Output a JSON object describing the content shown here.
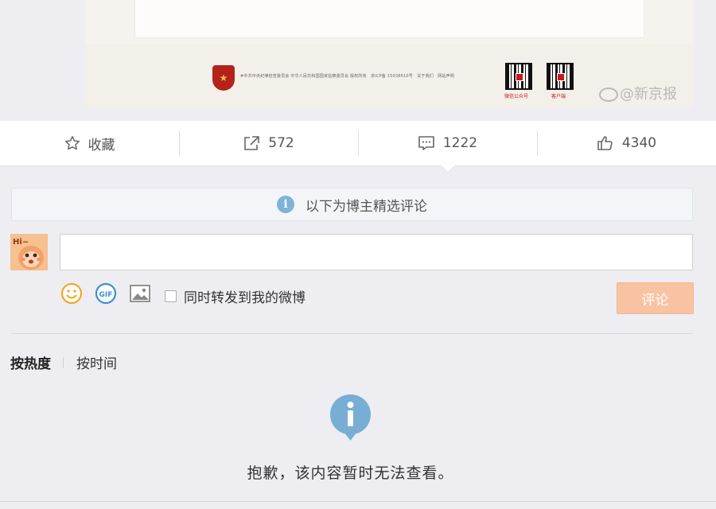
{
  "post_image": {
    "footer_text": "#中共中央纪律检查委员会 中华人民共和国国家监察委员会 版权所有　京ICP备 15038610号　关于我们　网站声明",
    "qr_caption_1": "微信公众号",
    "qr_caption_2": "客户端",
    "watermark": "@新京报"
  },
  "actions": {
    "favorite_label": "收藏",
    "repost_count": "572",
    "comment_count": "1222",
    "like_count": "4340",
    "active": "comment"
  },
  "notice": {
    "text": "以下为博主精选评论"
  },
  "composer": {
    "input_value": "",
    "input_placeholder": "",
    "repost_label": "同时转发到我的微博",
    "repost_checked": false,
    "submit_label": "评论"
  },
  "sort": {
    "tabs": [
      "按热度",
      "按时间"
    ],
    "active_index": 0
  },
  "empty_state": {
    "message": "抱歉，该内容暂时无法查看。"
  },
  "colors": {
    "page_bg": "#eeedf2",
    "submit_bg": "#f9c3a3",
    "info_blue": "#7fb2d6",
    "emoji_orange": "#f5a623",
    "gif_blue": "#3d8fd6"
  }
}
